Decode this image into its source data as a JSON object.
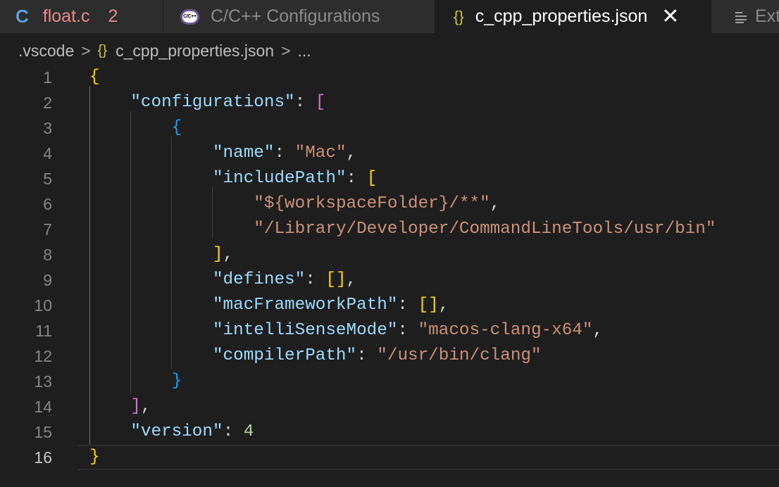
{
  "tabs": [
    {
      "icon": "c-language-icon",
      "icon_text": "C",
      "label": "float.c",
      "badge": "2"
    },
    {
      "icon": "cpp-extension-icon",
      "icon_text": "C/C++",
      "label": "C/C++ Configurations"
    },
    {
      "icon": "json-braces-icon",
      "icon_text": "{}",
      "label": "c_cpp_properties.json",
      "close": "✕",
      "active": true
    },
    {
      "icon": "lines-icon",
      "label": "Ext"
    }
  ],
  "breadcrumb": {
    "folder": ".vscode",
    "separator": ">",
    "file_icon": "{}",
    "file": "c_cpp_properties.json",
    "more": "..."
  },
  "editor": {
    "current_line": 16,
    "lines": [
      {
        "n": "1",
        "tokens": [
          {
            "t": "{",
            "c": "b1"
          }
        ]
      },
      {
        "n": "2",
        "tokens": [
          {
            "t": "    ",
            "c": "punc"
          },
          {
            "t": "\"configurations\"",
            "c": "key"
          },
          {
            "t": ": ",
            "c": "punc"
          },
          {
            "t": "[",
            "c": "b2"
          }
        ]
      },
      {
        "n": "3",
        "tokens": [
          {
            "t": "        ",
            "c": "punc"
          },
          {
            "t": "{",
            "c": "b3"
          }
        ]
      },
      {
        "n": "4",
        "tokens": [
          {
            "t": "            ",
            "c": "punc"
          },
          {
            "t": "\"name\"",
            "c": "key"
          },
          {
            "t": ": ",
            "c": "punc"
          },
          {
            "t": "\"Mac\"",
            "c": "str"
          },
          {
            "t": ",",
            "c": "punc"
          }
        ]
      },
      {
        "n": "5",
        "tokens": [
          {
            "t": "            ",
            "c": "punc"
          },
          {
            "t": "\"includePath\"",
            "c": "key"
          },
          {
            "t": ": ",
            "c": "punc"
          },
          {
            "t": "[",
            "c": "b1"
          }
        ]
      },
      {
        "n": "6",
        "tokens": [
          {
            "t": "                ",
            "c": "punc"
          },
          {
            "t": "\"${workspaceFolder}/**\"",
            "c": "str"
          },
          {
            "t": ",",
            "c": "punc"
          }
        ]
      },
      {
        "n": "7",
        "tokens": [
          {
            "t": "                ",
            "c": "punc"
          },
          {
            "t": "\"/Library/Developer/CommandLineTools/usr/bin\"",
            "c": "str"
          }
        ]
      },
      {
        "n": "8",
        "tokens": [
          {
            "t": "            ",
            "c": "punc"
          },
          {
            "t": "]",
            "c": "b1"
          },
          {
            "t": ",",
            "c": "punc"
          }
        ]
      },
      {
        "n": "9",
        "tokens": [
          {
            "t": "            ",
            "c": "punc"
          },
          {
            "t": "\"defines\"",
            "c": "key"
          },
          {
            "t": ": ",
            "c": "punc"
          },
          {
            "t": "[]",
            "c": "b1"
          },
          {
            "t": ",",
            "c": "punc"
          }
        ]
      },
      {
        "n": "10",
        "tokens": [
          {
            "t": "            ",
            "c": "punc"
          },
          {
            "t": "\"macFrameworkPath\"",
            "c": "key"
          },
          {
            "t": ": ",
            "c": "punc"
          },
          {
            "t": "[]",
            "c": "b1"
          },
          {
            "t": ",",
            "c": "punc"
          }
        ]
      },
      {
        "n": "11",
        "tokens": [
          {
            "t": "            ",
            "c": "punc"
          },
          {
            "t": "\"intelliSenseMode\"",
            "c": "key"
          },
          {
            "t": ": ",
            "c": "punc"
          },
          {
            "t": "\"macos-clang-x64\"",
            "c": "str"
          },
          {
            "t": ",",
            "c": "punc"
          }
        ]
      },
      {
        "n": "12",
        "tokens": [
          {
            "t": "            ",
            "c": "punc"
          },
          {
            "t": "\"compilerPath\"",
            "c": "key"
          },
          {
            "t": ": ",
            "c": "punc"
          },
          {
            "t": "\"/usr/bin/clang\"",
            "c": "str"
          }
        ]
      },
      {
        "n": "13",
        "tokens": [
          {
            "t": "        ",
            "c": "punc"
          },
          {
            "t": "}",
            "c": "b3"
          }
        ]
      },
      {
        "n": "14",
        "tokens": [
          {
            "t": "    ",
            "c": "punc"
          },
          {
            "t": "]",
            "c": "b2"
          },
          {
            "t": ",",
            "c": "punc"
          }
        ]
      },
      {
        "n": "15",
        "tokens": [
          {
            "t": "    ",
            "c": "punc"
          },
          {
            "t": "\"version\"",
            "c": "key"
          },
          {
            "t": ": ",
            "c": "punc"
          },
          {
            "t": "4",
            "c": "num"
          }
        ]
      },
      {
        "n": "16",
        "tokens": [
          {
            "t": "}",
            "c": "b1"
          }
        ]
      }
    ]
  },
  "colors": {
    "background": "#1e1e1e",
    "key": "#9cdcfe",
    "string": "#ce9178",
    "number": "#b5cea8",
    "bracket_level1": "#ffd700",
    "bracket_level2": "#da70d6",
    "bracket_level3": "#179fff"
  }
}
